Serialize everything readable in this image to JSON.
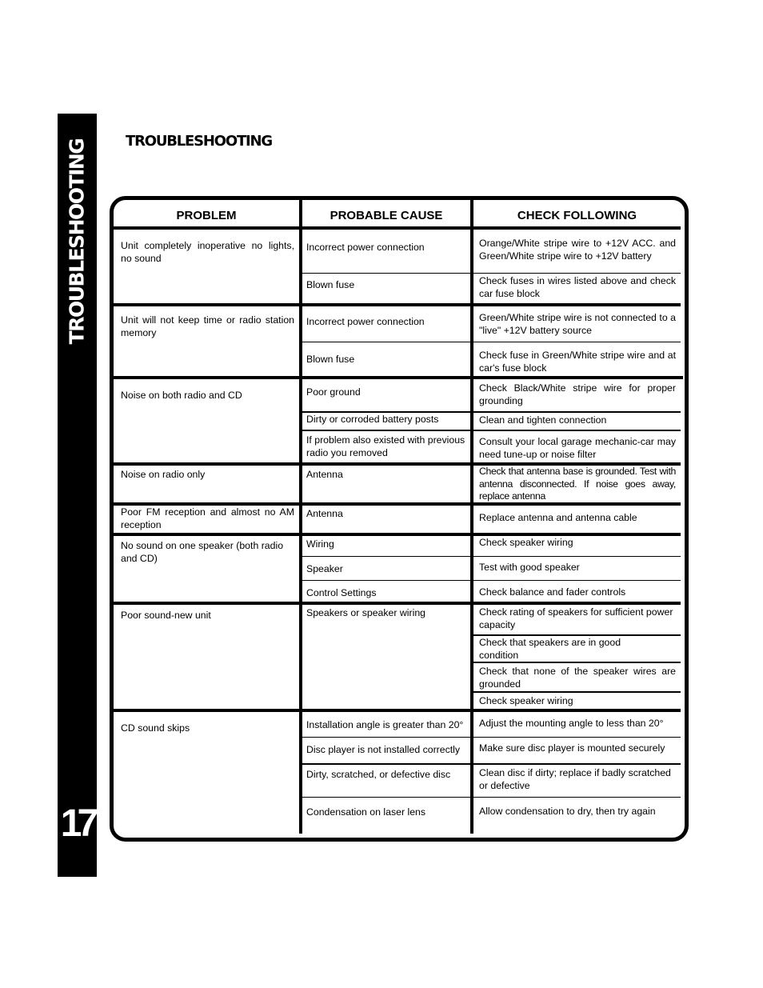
{
  "sidebar": {
    "title": "TROUBLESHOOTING",
    "page_number": "17"
  },
  "page": {
    "title": "TROUBLESHOOTING"
  },
  "table": {
    "headers": [
      "PROBLEM",
      "PROBABLE CAUSE",
      "CHECK FOLLOWING"
    ],
    "groups": [
      {
        "problem": "Unit completely inoperative no lights, no sound",
        "rows": [
          {
            "cause": "Incorrect power connection",
            "check": "Orange/White stripe wire to +12V  ACC. and Green/White stripe wire to +12V battery"
          },
          {
            "cause": "Blown fuse",
            "check": "Check fuses in wires listed above and check car fuse block"
          }
        ]
      },
      {
        "problem": "Unit will not keep time or radio station memory",
        "rows": [
          {
            "cause": "Incorrect power connection",
            "check": "Green/White stripe wire is not connected to a \"live\" +12V battery source"
          },
          {
            "cause": "Blown fuse",
            "check": "Check fuse in Green/White stripe wire and at car's fuse block"
          }
        ]
      },
      {
        "problem": "Noise on both radio and CD",
        "rows": [
          {
            "cause": "Poor ground",
            "check": "Check Black/White stripe wire for proper grounding"
          },
          {
            "cause": "Dirty or corroded battery posts",
            "check": "Clean and tighten connection"
          },
          {
            "cause": "If problem also existed with previous radio you removed",
            "check": "Consult your local garage mechanic-car may need tune-up or noise filter"
          }
        ]
      },
      {
        "problem": "Noise on radio only",
        "rows": [
          {
            "cause": "Antenna",
            "check": "Check that antenna base is grounded.  Test with antenna disconnected. If noise goes away, replace antenna"
          }
        ]
      },
      {
        "problem": "Poor FM reception and almost no AM reception",
        "rows": [
          {
            "cause": "Antenna",
            "check": "Replace antenna and antenna cable"
          }
        ]
      },
      {
        "problem": "No sound on one speaker (both radio and CD)",
        "rows": [
          {
            "cause": "Wiring",
            "check": "Check speaker wiring"
          },
          {
            "cause": "Speaker",
            "check": "Test with good speaker"
          },
          {
            "cause": "Control Settings",
            "check": "Check balance and fader controls"
          }
        ]
      },
      {
        "problem": "Poor sound-new unit",
        "cause": "Speakers or speaker wiring",
        "checks": [
          "Check rating of speakers for sufficient power capacity",
          "Check that speakers are in good condition",
          "Check that none of the speaker wires are grounded",
          "Check speaker wiring"
        ]
      },
      {
        "problem": "CD sound skips",
        "rows": [
          {
            "cause": "Installation angle is greater than 20°",
            "check": "Adjust the mounting angle to less than 20°"
          },
          {
            "cause": "Disc player is not installed correctly",
            "check": "Make sure disc player is mounted securely"
          },
          {
            "cause": "Dirty, scratched, or defective disc",
            "check": "Clean disc if dirty; replace if badly scratched or defective"
          },
          {
            "cause": "Condensation on laser lens",
            "check": "Allow condensation to dry, then try again"
          }
        ]
      }
    ]
  }
}
